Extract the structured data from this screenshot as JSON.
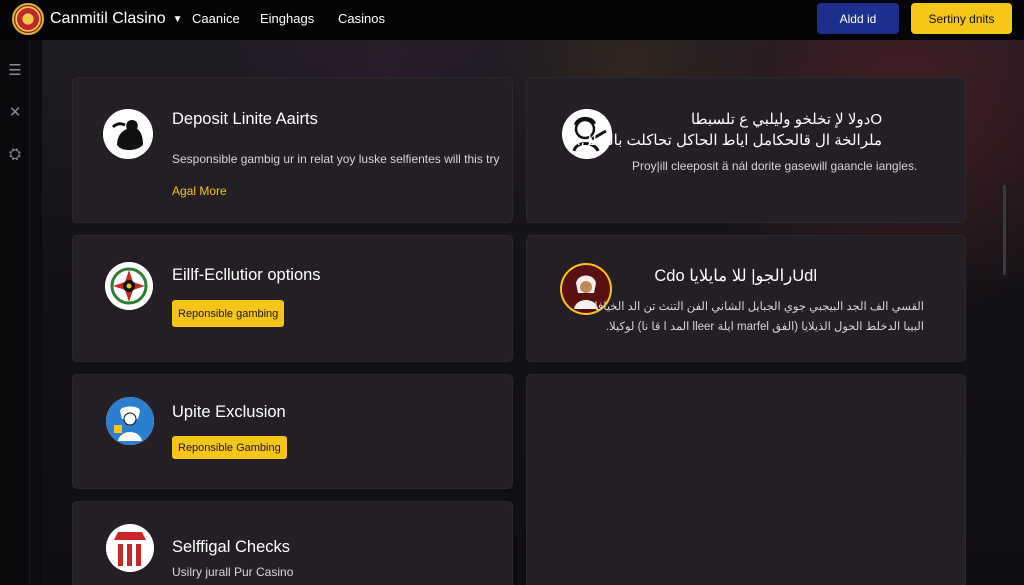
{
  "header": {
    "brand": "Canmitil Clasino",
    "nav": [
      "Caanice",
      "Einghags",
      "Casinos"
    ],
    "btn_primary": "Aldd id",
    "btn_secondary": "Sertiny dnits"
  },
  "sidebar": {
    "icons": [
      "menu-icon",
      "close-icon",
      "settings-icon"
    ]
  },
  "cards": [
    {
      "title": "Deposit Linite Aairts",
      "text": "Sesponsible gambig ur in relat yoy luske selfientes will this try",
      "link": "Agal More",
      "icon": "silhouette-icon"
    },
    {
      "title_line1": "Oدولا لإ تخلخو وليلبي ع تلسبطا",
      "title_line2": "ملرالخة ال قالحكامل اياط الحاكل تحاكلت بالبطل.",
      "text": "Proy|ill cleeposit ä nál dorite gasewill gaancle iangles.",
      "icon": "avatar-icon"
    },
    {
      "title": "Eillf-Ecllutior options",
      "badge": "Reponsible gambing",
      "icon": "wheel-icon"
    },
    {
      "title": "Udlرالجو| للا مايلايا Cdo",
      "text_line1": "القسي الف الجد البيجبي جوي الجبايل الشاني الفن التنث تن الد الخيافا",
      "text_line2": "البيبا الدخلط الحول الذيلايا (الفق marfel ايلة lleer المد ا قا نا) لوكيلا.",
      "icon": "person-icon"
    },
    {
      "title": "Upite Exclusion",
      "badge": "Reponsible Gambing",
      "icon": "shield-icon"
    },
    {
      "title": "Selffigal Checks",
      "text": "Usilry jurall Pur Casino",
      "icon": "stripes-icon"
    }
  ]
}
